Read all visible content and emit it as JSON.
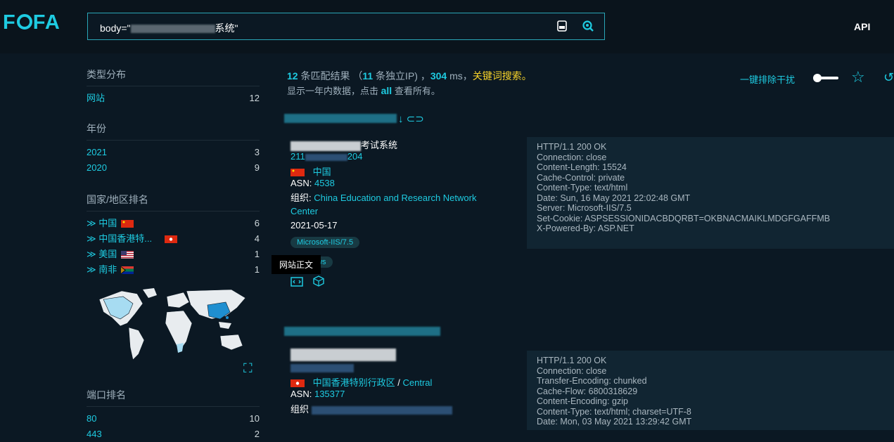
{
  "header": {
    "logo": "FOFA",
    "query_prefix": "body=\"",
    "query_suffix": "系统\"",
    "api_label": "API",
    "icons": [
      "image-search-icon",
      "search-icon"
    ]
  },
  "sidebar": {
    "type_title": "类型分布",
    "types": [
      {
        "label": "网站",
        "count": "12"
      }
    ],
    "year_title": "年份",
    "years": [
      {
        "label": "2021",
        "count": "3"
      },
      {
        "label": "2020",
        "count": "9"
      }
    ],
    "country_title": "国家/地区排名",
    "countries": [
      {
        "label": "≫ 中国",
        "count": "6",
        "flag": "cn-flag-icon"
      },
      {
        "label": "≫ 中国香港特...",
        "count": "4",
        "flag": "hk-flag-icon"
      },
      {
        "label": "≫ 美国",
        "count": "1",
        "flag": "us-flag-icon"
      },
      {
        "label": "≫ 南非",
        "count": "1",
        "flag": "za-flag-icon"
      }
    ],
    "port_title": "端口排名",
    "ports": [
      {
        "label": "80",
        "count": "10"
      },
      {
        "label": "443",
        "count": "2"
      }
    ]
  },
  "summary": {
    "count": "12",
    "count_text": " 条匹配结果 （",
    "ip_count": "11",
    "ip_text": " 条独立IP) ，",
    "ms": "304",
    "ms_text": " ms，",
    "keyword": "关键词搜索。",
    "line2_a": "显示一年内数据，点击 ",
    "line2_link": "all",
    "line2_b": " 查看所有。"
  },
  "toolbar": {
    "dedupe_label": "一键排除干扰",
    "toggle_state": "on"
  },
  "results": [
    {
      "title_suffix": "考试系统",
      "ip_prefix": "211",
      "ip_suffix": "204",
      "country": "中国",
      "asn_label": "ASN: ",
      "asn": "4538",
      "org_label": "组织: ",
      "org": "China Education and Research Network Center",
      "date": "2021-05-17",
      "tags": [
        "Microsoft-IIS/7.5",
        "ows"
      ],
      "http": "HTTP/1.1 200 OK\nConnection: close\nContent-Length: 15524\nCache-Control: private\nContent-Type: text/html\nDate: Sun, 16 May 2021 22:02:48 GMT\nServer: Microsoft-IIS/7.5\nSet-Cookie: ASPSESSIONIDACBDQRBT=OKBNACMAIKLMDGFGAFFMB\nX-Powered-By: ASP.NET"
    },
    {
      "country": "中国香港特别行政区",
      "sep": " / ",
      "region": "Central",
      "asn_label": "ASN: ",
      "asn": "135377",
      "org_label": "组织",
      "http": "HTTP/1.1 200 OK\nConnection: close\nTransfer-Encoding: chunked\nCache-Flow: 6800318629\nContent-Encoding: gzip\nContent-Type: text/html; charset=UTF-8\nDate: Mon, 03 May 2021 13:29:42 GMT"
    }
  ],
  "tooltip": "网站正文",
  "colors": {
    "accent": "#1ecbe1",
    "keyword": "#f7d32a",
    "bg": "#0b1823"
  }
}
